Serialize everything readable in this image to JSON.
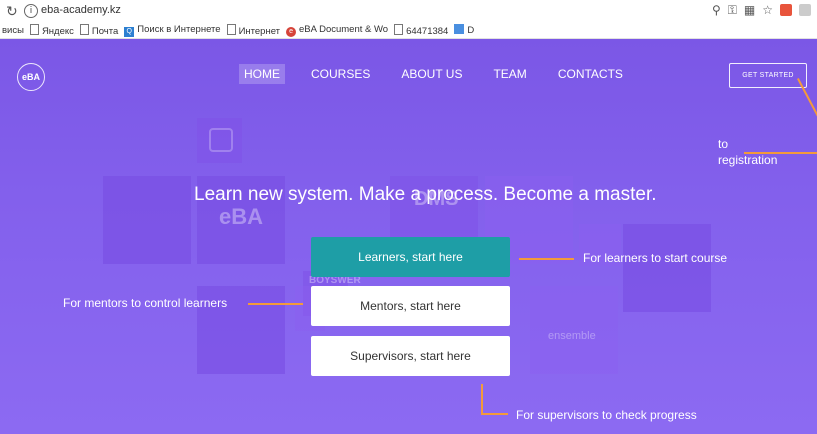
{
  "browser": {
    "url": "eba-academy.kz",
    "bookmarks": [
      "висы",
      "Яндекс",
      "Почта",
      "Поиск в Интернете",
      "Интернет",
      "eBA Document & Wo",
      "64471384",
      "D"
    ]
  },
  "header": {
    "logo": "eBA",
    "nav": [
      "HOME",
      "COURSES",
      "ABOUT US",
      "TEAM",
      "CONTACTS"
    ],
    "cta": "GET STARTED"
  },
  "hero": {
    "headline": "Learn new system. Make a process. Become a master.",
    "buttons": {
      "learners": "Learners, start here",
      "mentors": "Mentors, start here",
      "supervisors": "Supervisors, start here"
    }
  },
  "background_tiles": {
    "eba": "eBA",
    "dms": "DMS",
    "boyswer": "BOYSWER",
    "ensemble": "ensemble"
  },
  "annotations": {
    "registration_1": "to",
    "registration_2": "registration",
    "learners": "For learners to start course",
    "mentors": "For mentors to control learners",
    "supervisors": "For supervisors to check progress"
  },
  "colors": {
    "page_bg": "#8360ec",
    "primary_button": "#1e9ea6",
    "annotation_line": "#f39a3a"
  }
}
